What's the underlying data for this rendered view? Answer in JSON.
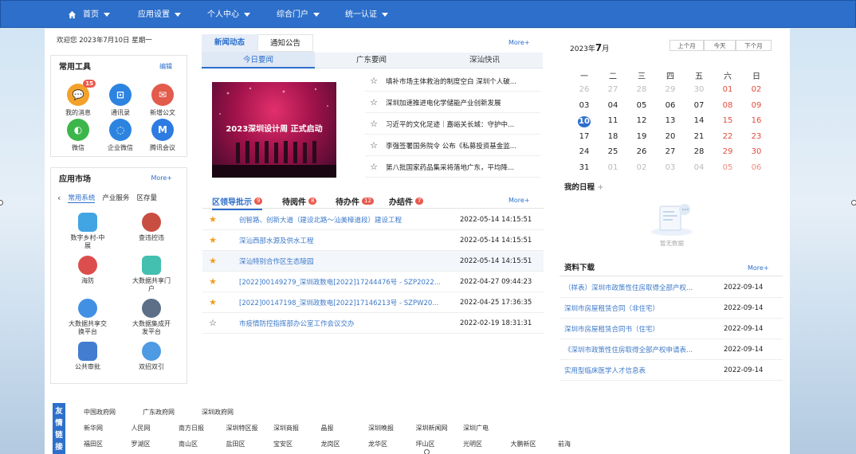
{
  "nav": [
    "首页",
    "应用设置",
    "个人中心",
    "综合门户",
    "统一认证"
  ],
  "welcome": "欢迎您 2023年7月10日 星期一",
  "tools": {
    "title": "常用工具",
    "edit": "编辑",
    "items": [
      {
        "label": "我的消息",
        "icon": "chat-icon",
        "color": "#f2a22a",
        "badge": "15"
      },
      {
        "label": "通讯录",
        "icon": "address-book-icon",
        "color": "#2d84e0"
      },
      {
        "label": "新增公文",
        "icon": "mail-icon",
        "color": "#e25b4c"
      },
      {
        "label": "微信",
        "icon": "wechat-icon",
        "color": "#3cb64a"
      },
      {
        "label": "企业微信",
        "icon": "wecom-icon",
        "color": "#2d84e0"
      },
      {
        "label": "腾讯会议",
        "icon": "meeting-icon",
        "color": "#2d7be3"
      }
    ]
  },
  "market": {
    "title": "应用市场",
    "more": "More+",
    "tabs": [
      "常用系统",
      "产业服务",
      "区存量"
    ],
    "items": [
      {
        "label": "数字乡村-中\n展",
        "icon": "digital-village-icon",
        "color": "#2d9be0"
      },
      {
        "label": "查违控违",
        "icon": "emblem-icon",
        "color": "#c23b2e"
      },
      {
        "label": "海防",
        "icon": "shield-icon",
        "color": "#d83b3b"
      },
      {
        "label": "大数据共享门\n户",
        "icon": "data-portal-icon",
        "color": "#2fb9a6"
      },
      {
        "label": "大数据共享交\n换平台",
        "icon": "data-exchange-icon",
        "color": "#2d84e0"
      },
      {
        "label": "大数据集成开\n发平台",
        "icon": "data-dev-icon",
        "color": "#4a5f7a"
      },
      {
        "label": "公共审批",
        "icon": "approval-icon",
        "color": "#2d6fcb"
      },
      {
        "label": "双招双引",
        "icon": "globe-icon",
        "color": "#3b8fe0"
      }
    ]
  },
  "news": {
    "tabs": [
      "新闻动态",
      "通知公告"
    ],
    "more": "More+",
    "subtabs": [
      "今日要闻",
      "广东要闻",
      "深汕快讯"
    ],
    "image_text": "2023深圳设计周 正式启动",
    "items": [
      "填补市场主体救治的制度空白 深圳个人破...",
      "深圳加速推进电化学储能产业创新发展",
      "习近平的文化足迹｜嘉峪关长城：守护中...",
      "李强签署国务院令 公布《私募投资基金监...",
      "第八批国家药品集采将落地广东，平均降..."
    ]
  },
  "work": {
    "tabs": [
      {
        "label": "区领导批示",
        "n": "9"
      },
      {
        "label": "待阅件",
        "n": "8"
      },
      {
        "label": "待办件",
        "n": "12"
      },
      {
        "label": "办结件",
        "n": "7"
      }
    ],
    "more": "More+",
    "rows": [
      {
        "title": "创智路、创新大道（建设北路～汕美樟道段）建设工程",
        "date": "2022-05-14 14:15:51",
        "star": true
      },
      {
        "title": "深汕西部水源及供水工程",
        "date": "2022-05-14 14:15:51",
        "star": true
      },
      {
        "title": "深汕特别合作区生态陵园",
        "date": "2022-05-14 14:15:51",
        "star": true
      },
      {
        "title": "[2022]00149279_深圳政数电[2022]17244476号 - SZP2022...",
        "date": "2022-04-27 09:44:23",
        "star": true
      },
      {
        "title": "[2022]00147198_深圳政数电[2022]17146213号 - SZPW20...",
        "date": "2022-04-25 17:36:35",
        "star": true
      },
      {
        "title": "市疫情防控指挥部办公室工作会议交办",
        "date": "2022-02-19 18:31:31",
        "star": false
      }
    ]
  },
  "calendar": {
    "year": "2023年",
    "month": "7",
    "unit": "月",
    "prev": "上个月",
    "today": "今天",
    "next": "下个月",
    "weekdays": [
      "一",
      "二",
      "三",
      "四",
      "五",
      "六",
      "日"
    ],
    "weeks": [
      [
        "26",
        "27",
        "28",
        "29",
        "30",
        "01",
        "02"
      ],
      [
        "03",
        "04",
        "05",
        "06",
        "07",
        "08",
        "09"
      ],
      [
        "10",
        "11",
        "12",
        "13",
        "14",
        "15",
        "16"
      ],
      [
        "17",
        "18",
        "19",
        "20",
        "21",
        "22",
        "23"
      ],
      [
        "24",
        "25",
        "26",
        "27",
        "28",
        "29",
        "30"
      ],
      [
        "31",
        "01",
        "02",
        "03",
        "04",
        "05",
        "06"
      ]
    ]
  },
  "schedule": {
    "title": "我的日程",
    "add": "+",
    "empty": "暂无数据"
  },
  "downloads": {
    "title": "资料下载",
    "more": "More+",
    "rows": [
      {
        "title": "（样表）深圳市政策性住房取得全部产权...",
        "date": "2022-09-14"
      },
      {
        "title": "深圳市房屋租赁合同（非住宅）",
        "date": "2022-09-14"
      },
      {
        "title": "深圳市房屋租赁合同书（住宅）",
        "date": "2022-09-14"
      },
      {
        "title": "《深圳市政策性住房取得全部产权申请表...",
        "date": "2022-09-14"
      },
      {
        "title": "实用型临床医学人才信息表",
        "date": "2022-09-14"
      }
    ]
  },
  "links": {
    "label": "友情链接",
    "rows": [
      [
        "中国政府网",
        "广东政府网",
        "深圳政府网"
      ],
      [
        "新华网",
        "人民网",
        "南方日报",
        "深圳特区报",
        "深圳商报",
        "晶报",
        "深圳晚报",
        "深圳新闻网",
        "深圳广电"
      ],
      [
        "福田区",
        "罗湖区",
        "南山区",
        "盐田区",
        "宝安区",
        "龙岗区",
        "龙华区",
        "坪山区",
        "光明区",
        "大鹏新区",
        "前海"
      ]
    ]
  }
}
